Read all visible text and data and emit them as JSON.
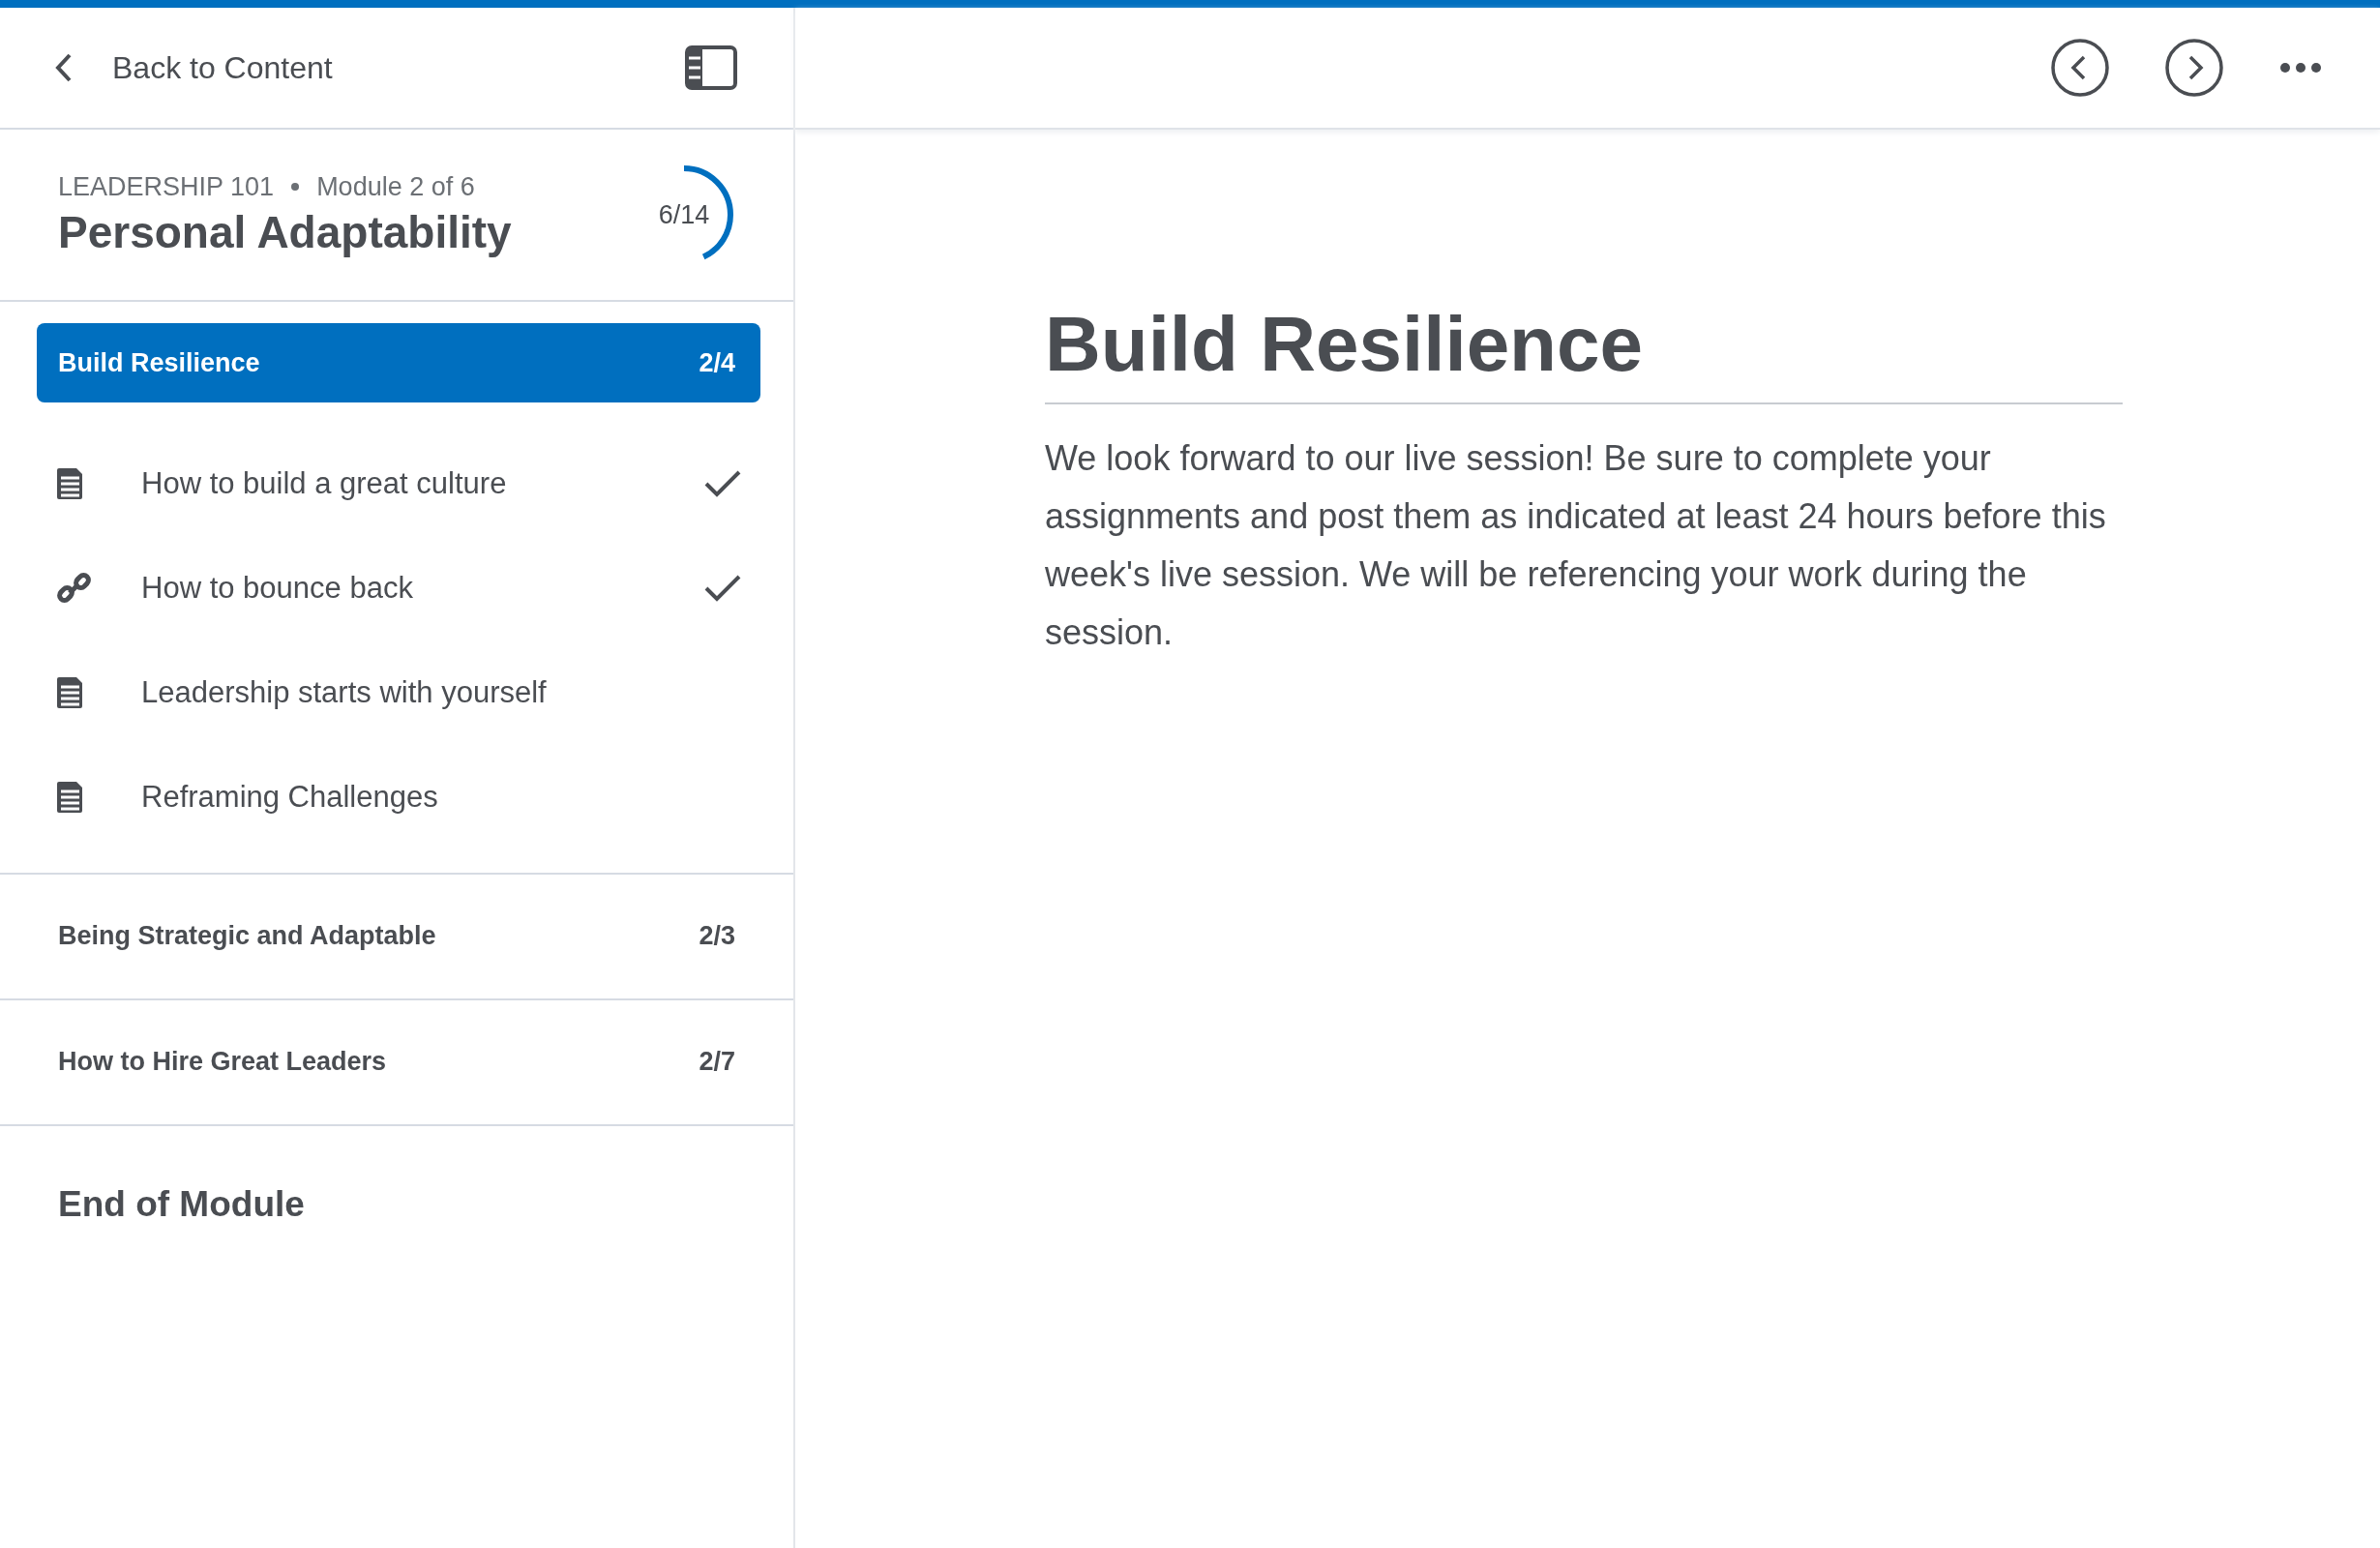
{
  "sidebar": {
    "back_link": "Back to Content",
    "course": {
      "name": "LEADERSHIP 101",
      "module": "Module 2 of 6",
      "title": "Personal Adaptability",
      "progress": "6/14",
      "level": 0.43
    },
    "sections": [
      {
        "label": "Build Resilience",
        "count": "2/4",
        "selected": true,
        "children": [
          {
            "label": "How to build a great culture",
            "kind": "document",
            "checked": true
          },
          {
            "label": "How to bounce back",
            "kind": "link",
            "checked": true
          },
          {
            "label": "Leadership starts with yourself",
            "kind": "document",
            "checked": false
          },
          {
            "label": "Reframing Challenges",
            "kind": "document",
            "checked": false
          }
        ]
      },
      {
        "label": "Being Strategic and Adaptable",
        "count": "2/3",
        "selected": false
      },
      {
        "label": "How to Hire Great Leaders",
        "count": "2/7",
        "selected": false
      }
    ],
    "end_label": "End of Module"
  },
  "content": {
    "title": "Build Resilience",
    "body": "We look forward to our live session!  Be sure to complete your assignments and post them as indicated at least 24 hours before this week's live session.  We will be referencing your work during the session."
  }
}
